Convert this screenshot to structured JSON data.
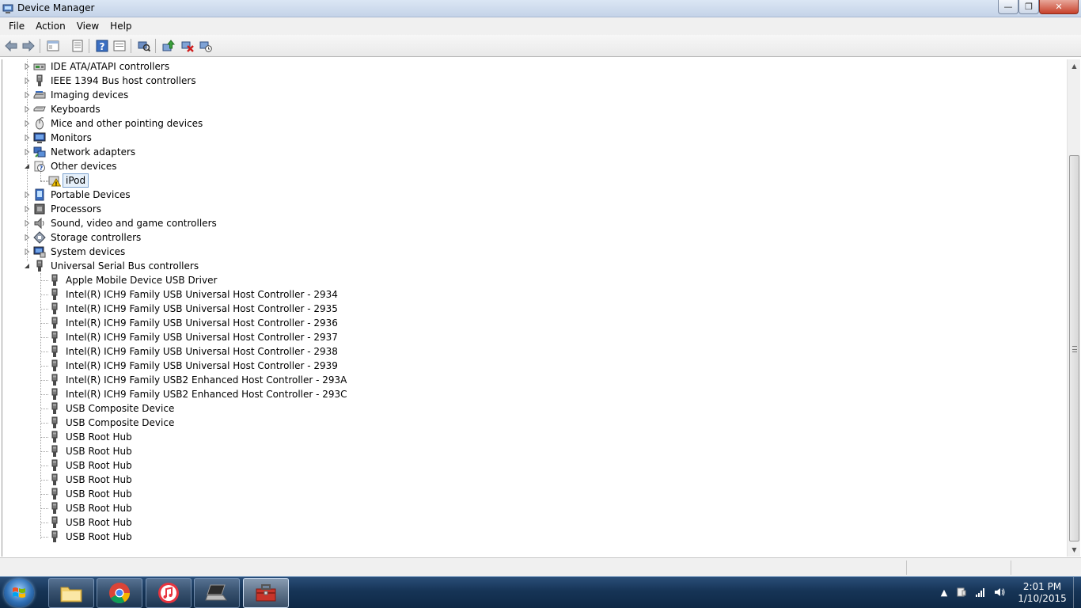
{
  "window": {
    "title": "Device Manager",
    "minimize_symbol": "—",
    "maximize_symbol": "❐",
    "close_symbol": "✕"
  },
  "menu": [
    "File",
    "Action",
    "Help"
  ],
  "menu_view": "View",
  "toolbar": {
    "icons": [
      "back-icon",
      "forward-icon",
      "properties-icon",
      "device-manager-view-icon",
      "help-icon",
      "console-tree-icon",
      "scan-hardware-icon",
      "update-driver-icon",
      "uninstall-icon",
      "disable-icon"
    ]
  },
  "tree": {
    "categories_top": [
      {
        "label": "IDE ATA/ATAPI controllers",
        "icon": "ide-controller-icon",
        "expanded": false
      },
      {
        "label": "IEEE 1394 Bus host controllers",
        "icon": "ieee1394-icon",
        "expanded": false
      },
      {
        "label": "Imaging devices",
        "icon": "imaging-device-icon",
        "expanded": false
      },
      {
        "label": "Keyboards",
        "icon": "keyboard-icon",
        "expanded": false
      },
      {
        "label": "Mice and other pointing devices",
        "icon": "mouse-icon",
        "expanded": false
      },
      {
        "label": "Monitors",
        "icon": "monitor-icon",
        "expanded": false
      },
      {
        "label": "Network adapters",
        "icon": "network-adapter-icon",
        "expanded": false
      },
      {
        "label": "Other devices",
        "icon": "unknown-device-icon",
        "expanded": true
      }
    ],
    "other_devices_children": [
      {
        "label": "iPod",
        "icon": "warning-device-icon",
        "selected": true
      }
    ],
    "categories_mid": [
      {
        "label": "Portable Devices",
        "icon": "portable-device-icon",
        "expanded": false
      },
      {
        "label": "Processors",
        "icon": "processor-icon",
        "expanded": false
      },
      {
        "label": "Sound, video and game controllers",
        "icon": "speaker-icon",
        "expanded": false
      },
      {
        "label": "Storage controllers",
        "icon": "storage-controller-icon",
        "expanded": false
      },
      {
        "label": "System devices",
        "icon": "system-device-icon",
        "expanded": false
      },
      {
        "label": "Universal Serial Bus controllers",
        "icon": "usb-icon",
        "expanded": true
      }
    ],
    "usb_children": [
      "Apple Mobile Device USB Driver",
      "Intel(R) ICH9 Family USB Universal Host Controller - 2934",
      "Intel(R) ICH9 Family USB Universal Host Controller - 2935",
      "Intel(R) ICH9 Family USB Universal Host Controller - 2936",
      "Intel(R) ICH9 Family USB Universal Host Controller - 2937",
      "Intel(R) ICH9 Family USB Universal Host Controller - 2938",
      "Intel(R) ICH9 Family USB Universal Host Controller - 2939",
      "Intel(R) ICH9 Family USB2 Enhanced Host Controller - 293A",
      "Intel(R) ICH9 Family USB2 Enhanced Host Controller - 293C",
      "USB Composite Device",
      "USB Composite Device",
      "USB Root Hub",
      "USB Root Hub",
      "USB Root Hub",
      "USB Root Hub",
      "USB Root Hub",
      "USB Root Hub",
      "USB Root Hub",
      "USB Root Hub"
    ]
  },
  "taskbar": {
    "apps": [
      {
        "name": "explorer",
        "icon": "folder-icon",
        "active": false
      },
      {
        "name": "chrome",
        "icon": "chrome-icon",
        "active": false
      },
      {
        "name": "itunes",
        "icon": "itunes-icon",
        "active": false
      },
      {
        "name": "laptop",
        "icon": "laptop-icon",
        "active": false
      },
      {
        "name": "device-manager",
        "icon": "toolbox-icon",
        "active": true
      }
    ],
    "tray_icons": [
      "show-hidden-icon",
      "device-tray-icon",
      "network-signal-icon",
      "volume-icon"
    ],
    "clock_time": "2:01 PM",
    "clock_date": "1/10/2015"
  },
  "colors": {
    "taskbar": "#163456",
    "selection_border": "#7da2ce",
    "selection_fill": "#e6f0fa",
    "warning": "#f5c400"
  }
}
